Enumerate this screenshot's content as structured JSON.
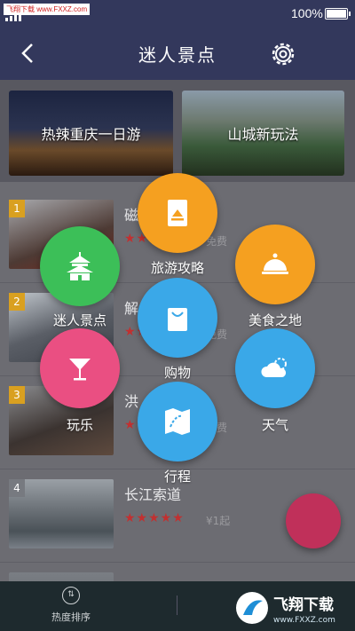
{
  "status_bar": {
    "watermark": "飞翔下载 www.FXXZ.com",
    "battery": "100%"
  },
  "nav": {
    "back_icon": "chevron-left-icon",
    "title": "迷人景点",
    "settings_icon": "gear-icon"
  },
  "banners": [
    "热辣重庆一日游",
    "山城新玩法"
  ],
  "list": [
    {
      "rank": "1",
      "name": "磁",
      "stars": "★★★★★",
      "price": "免费"
    },
    {
      "rank": "2",
      "name": "解",
      "stars": "★★★★★",
      "price": "免费"
    },
    {
      "rank": "3",
      "name": "洪",
      "stars": "★★★★★",
      "price": "免费"
    },
    {
      "rank": "4",
      "name": "长江索道",
      "stars": "★★★★★",
      "price": "¥1起"
    },
    {
      "rank": "",
      "name": "",
      "stars": "",
      "price": ""
    }
  ],
  "menu": [
    {
      "label": "旅游攻略",
      "icon": "book-icon",
      "color": "#f5a020"
    },
    {
      "label": "迷人景点",
      "icon": "temple-icon",
      "color": "#3cbf58"
    },
    {
      "label": "美食之地",
      "icon": "food-cloche-icon",
      "color": "#f5a020"
    },
    {
      "label": "购物",
      "icon": "shopping-bag-icon",
      "color": "#3aa8e8"
    },
    {
      "label": "玩乐",
      "icon": "cocktail-glass-icon",
      "color": "#ea4f82"
    },
    {
      "label": "天气",
      "icon": "weather-cloud-icon",
      "color": "#3aa8e8"
    },
    {
      "label": "行程",
      "icon": "map-route-icon",
      "color": "#3aa8e8"
    }
  ],
  "bottom_bar": {
    "sort_label": "热度排序",
    "sort_icon": "sort-icon",
    "logo_text": "飞翔下载",
    "logo_url": "www.FXXZ.com"
  }
}
